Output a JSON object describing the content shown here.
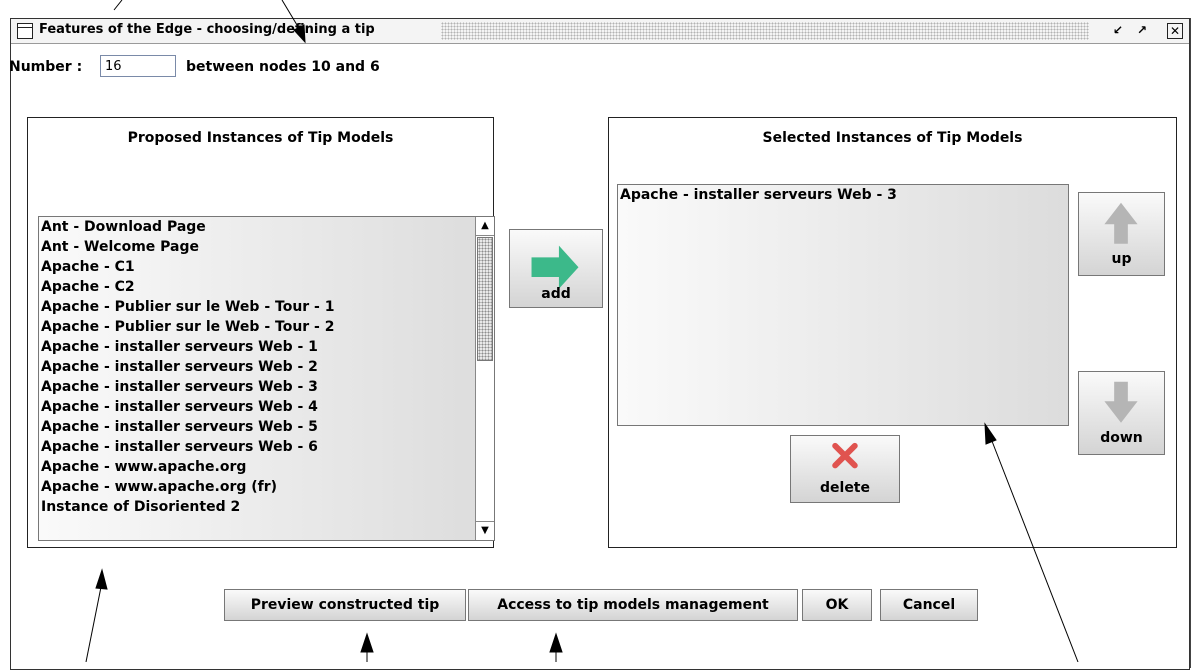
{
  "window": {
    "title": "Features of the Edge - choosing/defining a tip",
    "controls": [
      "minimize",
      "maximize",
      "close"
    ]
  },
  "edge": {
    "number_label": "Number :",
    "number_value": "16",
    "between_text": "between nodes 10 and 6"
  },
  "proposed": {
    "title": "Proposed Instances of Tip Models",
    "items": [
      "Ant - Download Page",
      "Ant - Welcome Page",
      "Apache - C1",
      "Apache - C2",
      "Apache - Publier sur le Web - Tour - 1",
      "Apache - Publier sur le Web - Tour - 2",
      "Apache - installer serveurs Web - 1",
      "Apache - installer serveurs Web - 2",
      "Apache - installer serveurs Web - 3",
      "Apache - installer serveurs Web - 4",
      "Apache - installer serveurs Web - 5",
      "Apache - installer serveurs Web - 6",
      "Apache - www.apache.org",
      "Apache - www.apache.org (fr)",
      "Instance of Disoriented 2"
    ]
  },
  "selected": {
    "title": "Selected Instances of Tip Models",
    "items": [
      "Apache - installer serveurs Web - 3"
    ]
  },
  "buttons": {
    "add": "add",
    "up": "up",
    "down": "down",
    "delete": "delete",
    "preview": "Preview constructed tip",
    "access": "Access to tip models management",
    "ok": "OK",
    "cancel": "Cancel"
  },
  "colors": {
    "add_arrow": "#3cb98a",
    "up_down_arrow": "#b5b5b5",
    "delete_x": "#e0534f"
  },
  "icons": {
    "add": "right-arrow-icon",
    "up": "up-arrow-icon",
    "down": "down-arrow-icon",
    "delete": "x-icon"
  }
}
